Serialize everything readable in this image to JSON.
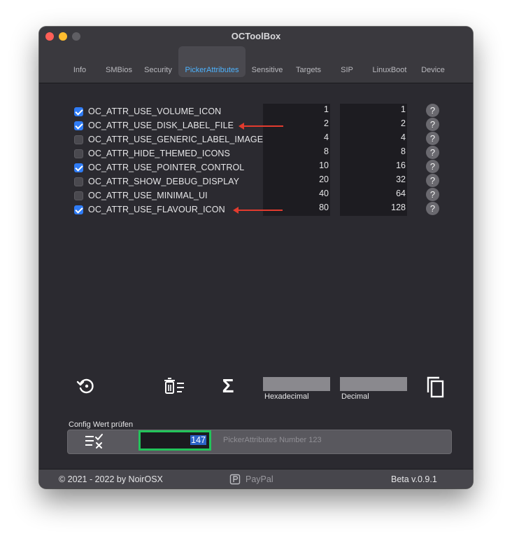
{
  "window": {
    "title": "OCToolBox"
  },
  "tabs": [
    {
      "label": "Info"
    },
    {
      "label": "SMBios"
    },
    {
      "label": "Security"
    },
    {
      "label": "PickerAttributes"
    },
    {
      "label": "Sensitive"
    },
    {
      "label": "Targets"
    },
    {
      "label": "SIP"
    },
    {
      "label": "LinuxBoot"
    },
    {
      "label": "Device"
    }
  ],
  "active_tab": "PickerAttributes",
  "attributes": [
    {
      "label": "OC_ATTR_USE_VOLUME_ICON",
      "checked": true,
      "hex": "1",
      "dec": "1"
    },
    {
      "label": "OC_ATTR_USE_DISK_LABEL_FILE",
      "checked": true,
      "hex": "2",
      "dec": "2"
    },
    {
      "label": "OC_ATTR_USE_GENERIC_LABEL_IMAGE",
      "checked": false,
      "hex": "4",
      "dec": "4"
    },
    {
      "label": "OC_ATTR_HIDE_THEMED_ICONS",
      "checked": false,
      "hex": "8",
      "dec": "8"
    },
    {
      "label": "OC_ATTR_USE_POINTER_CONTROL",
      "checked": true,
      "hex": "10",
      "dec": "16"
    },
    {
      "label": "OC_ATTR_SHOW_DEBUG_DISPLAY",
      "checked": false,
      "hex": "20",
      "dec": "32"
    },
    {
      "label": "OC_ATTR_USE_MINIMAL_UI",
      "checked": false,
      "hex": "40",
      "dec": "64"
    },
    {
      "label": "OC_ATTR_USE_FLAVOUR_ICON",
      "checked": true,
      "hex": "80",
      "dec": "128"
    }
  ],
  "help_glyph": "?",
  "toolbar": {
    "reset_icon": "reset-icon",
    "clear_icon": "clear-list-icon",
    "sum_icon": "sum-icon",
    "sum_glyph": "Σ",
    "copy_icon": "copy-icon",
    "hex_label": "Hexadecimal",
    "dec_label": "Decimal",
    "hex_value": "",
    "dec_value": ""
  },
  "config_check": {
    "title": "Config Wert prüfen",
    "icon": "check-list-icon",
    "value": "147",
    "placeholder": "PickerAttributes Number 123"
  },
  "footer": {
    "copyright": "© 2021 - 2022 by NoirOSX",
    "paypal": "PayPal",
    "version": "Beta v.0.9.1"
  },
  "colors": {
    "window_bg": "#2b2a30",
    "accent_blue": "#4db3ff",
    "checkbox_on": "#2f7cf6",
    "annotation_arrow": "#e23b2e",
    "input_highlight": "#22c35a"
  }
}
